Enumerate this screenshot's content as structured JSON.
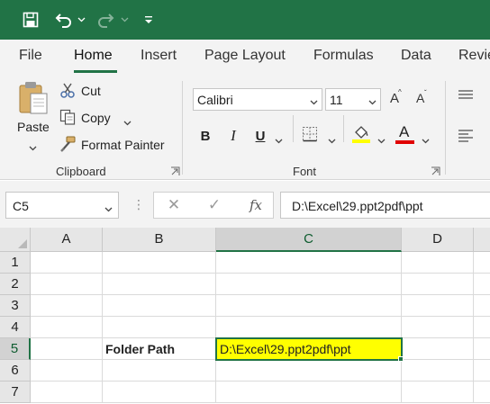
{
  "quick_access": {
    "save_icon": "save-icon",
    "undo_icon": "undo-icon",
    "redo_icon": "redo-icon",
    "customize_icon": "customize-quick-access-icon"
  },
  "tabs": [
    "File",
    "Home",
    "Insert",
    "Page Layout",
    "Formulas",
    "Data",
    "Revie"
  ],
  "active_tab": "Home",
  "clipboard": {
    "paste_label": "Paste",
    "cut_label": "Cut",
    "copy_label": "Copy",
    "format_painter_label": "Format Painter",
    "group_label": "Clipboard"
  },
  "font": {
    "font_name": "Calibri",
    "font_size": "11",
    "grow_label": "A",
    "shrink_label": "A",
    "bold_label": "B",
    "italic_label": "I",
    "underline_label": "U",
    "font_color_label": "A",
    "group_label": "Font",
    "highlight_color": "#ffff00",
    "font_color": "#e00000"
  },
  "formula_bar": {
    "name_box": "C5",
    "cancel_symbol": "✕",
    "enter_symbol": "✓",
    "fx_label": "fx",
    "formula": "D:\\Excel\\29.ppt2pdf\\ppt"
  },
  "grid": {
    "columns": [
      "A",
      "B",
      "C",
      "D"
    ],
    "rows": [
      "1",
      "2",
      "3",
      "4",
      "5",
      "6",
      "7"
    ],
    "selected_column": "C",
    "selected_row": "5",
    "cells": {
      "B5": "Folder Path",
      "C5": "D:\\Excel\\29.ppt2pdf\\ppt"
    },
    "accent_color": "#217346",
    "highlight_fill": "#ffff00"
  }
}
